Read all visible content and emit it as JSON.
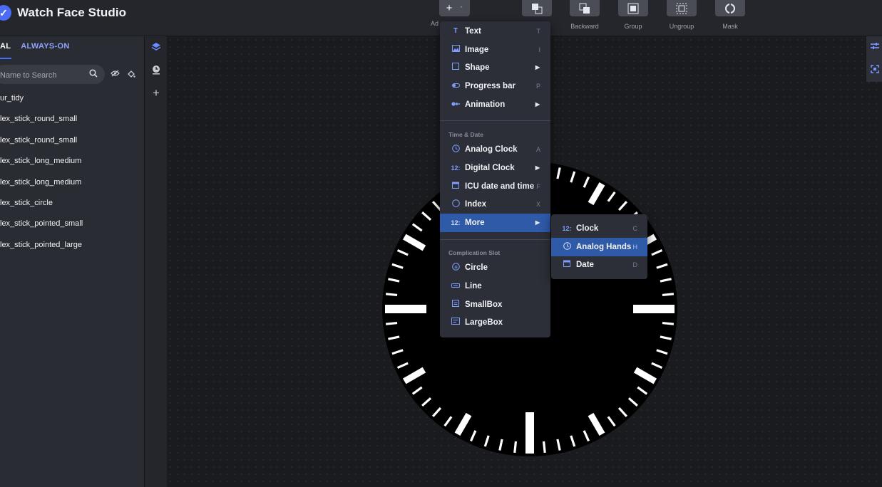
{
  "app": {
    "title": "Watch Face Studio"
  },
  "toolbar": {
    "add_label": "Ad",
    "buttons": [
      {
        "label": "Backward"
      },
      {
        "label": "Group"
      },
      {
        "label": "Ungroup"
      },
      {
        "label": "Mask"
      }
    ]
  },
  "left_panel": {
    "tabs": [
      "AL",
      "ALWAYS-ON"
    ],
    "search_placeholder": "Name to Search",
    "layers": [
      "ur_tidy",
      "lex_stick_round_small",
      "lex_stick_round_small",
      "lex_stick_long_medium",
      "lex_stick_long_medium",
      "lex_stick_circle",
      "lex_stick_pointed_small",
      "lex_stick_pointed_large"
    ]
  },
  "add_menu": {
    "items": [
      {
        "label": "Text",
        "shortcut": "T",
        "icon": "text-icon"
      },
      {
        "label": "Image",
        "shortcut": "I",
        "icon": "image-icon"
      },
      {
        "label": "Shape",
        "shortcut": "",
        "icon": "shape-icon"
      },
      {
        "label": "Progress bar",
        "shortcut": "P",
        "icon": "progress-bar-icon"
      },
      {
        "label": "Animation",
        "shortcut": "",
        "icon": "animation-icon"
      }
    ],
    "time_date_header": "Time & Date",
    "time_date_items": [
      {
        "label": "Analog Clock",
        "shortcut": "A",
        "icon": "analog-clock-icon"
      },
      {
        "label": "Digital Clock",
        "shortcut": "",
        "icon": "digital-clock-icon"
      },
      {
        "label": "ICU date and time",
        "shortcut": "F",
        "icon": "calendar-icon"
      },
      {
        "label": "Index",
        "shortcut": "X",
        "icon": "index-icon"
      },
      {
        "label": "More",
        "shortcut": "",
        "icon": "more-icon"
      }
    ],
    "complication_header": "Complication Slot",
    "complication_items": [
      {
        "label": "Circle",
        "icon": "circle-slot-icon"
      },
      {
        "label": "Line",
        "icon": "line-slot-icon"
      },
      {
        "label": "SmallBox",
        "icon": "smallbox-icon"
      },
      {
        "label": "LargeBox",
        "icon": "largebox-icon"
      }
    ]
  },
  "more_submenu": {
    "items": [
      {
        "label": "Clock",
        "shortcut": "C",
        "icon": "digital-clock-icon"
      },
      {
        "label": "Analog Hands",
        "shortcut": "H",
        "icon": "clock-hands-icon"
      },
      {
        "label": "Date",
        "shortcut": "D",
        "icon": "calendar-icon"
      }
    ]
  },
  "colors": {
    "accent": "#4d6cf5",
    "highlight": "#2f5aa8",
    "panel": "#2a2c33",
    "canvas": "#1a1b1e"
  }
}
